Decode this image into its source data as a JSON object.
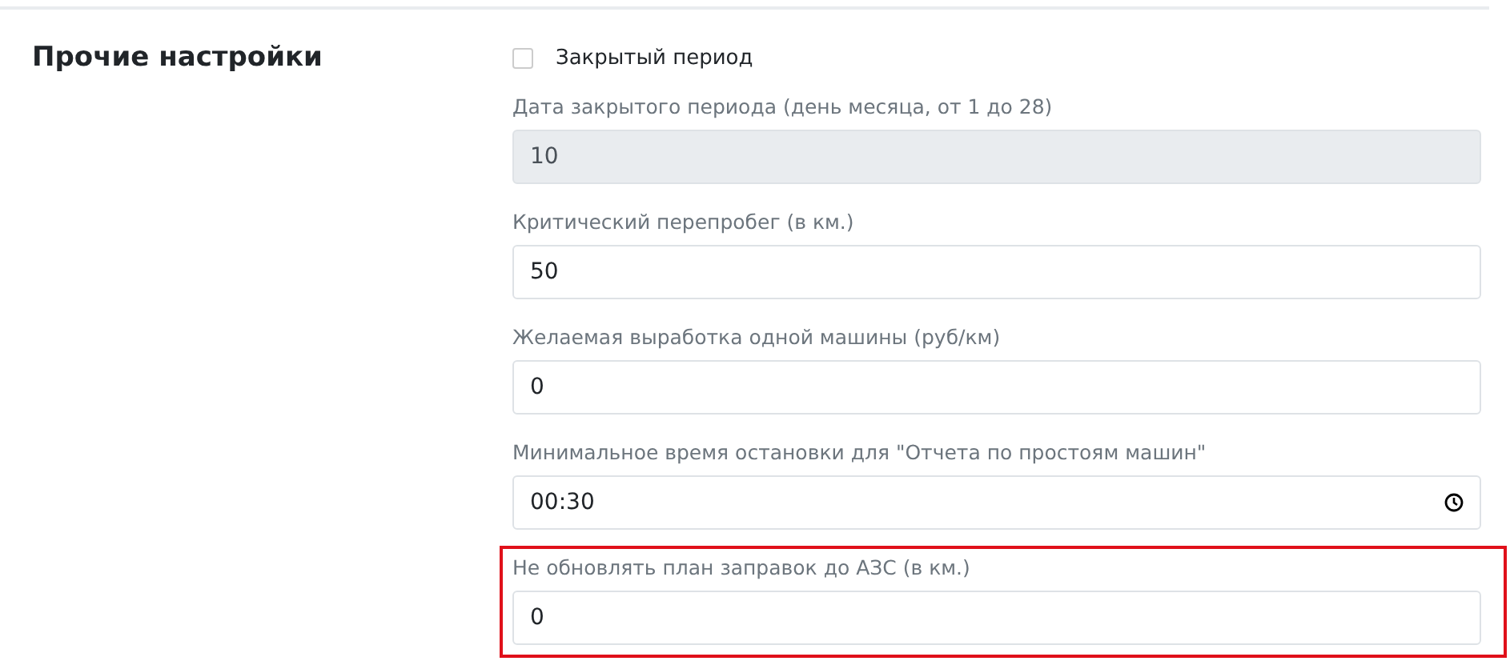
{
  "section": {
    "title": "Прочие настройки"
  },
  "fields": [
    {
      "kind": "checkbox",
      "label": "Закрытый период",
      "checked": false
    },
    {
      "kind": "input",
      "label": "Дата закрытого периода (день месяца, от 1 до 28)",
      "value": "10",
      "disabled": true,
      "highlighted": false
    },
    {
      "kind": "input",
      "label": "Критический перепробег (в км.)",
      "value": "50",
      "disabled": false,
      "highlighted": false
    },
    {
      "kind": "input",
      "label": "Желаемая выработка одной машины (руб/км)",
      "value": "0",
      "disabled": false,
      "highlighted": false
    },
    {
      "kind": "time",
      "label": "Минимальное время остановки для \"Отчета по простоям машин\"",
      "value": "00:30",
      "disabled": false,
      "highlighted": false
    },
    {
      "kind": "input",
      "label": "Не обновлять план заправок до АЗС (в км.)",
      "value": "0",
      "disabled": false,
      "highlighted": true
    }
  ]
}
